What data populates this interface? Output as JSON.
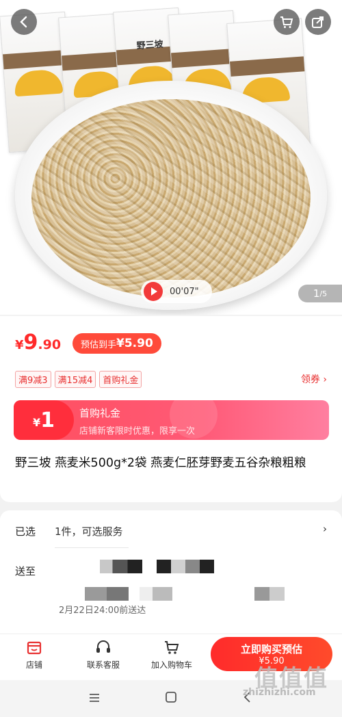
{
  "hero": {
    "video_time": "00'07\"",
    "image_counter_current": "1",
    "image_counter_total": "/5",
    "package_brand": "野三坡"
  },
  "price": {
    "currency": "¥",
    "integer": "9",
    "decimal": ".90",
    "estimate_label": "预估到手",
    "estimate_value": "¥5.90"
  },
  "coupons": [
    "满9减3",
    "满15减4",
    "首购礼金"
  ],
  "coupon_link": "领券 ›",
  "gift": {
    "currency": "¥",
    "amount": "1",
    "title": "首购礼金",
    "subtitle": "店铺新客限时优惠，限享一次"
  },
  "product_title": "野三坡 燕麦米500g*2袋 燕麦仁胚芽野麦五谷杂粮粗粮",
  "options": {
    "selected_label": "已选",
    "selected_value": "1件，可选服务",
    "ship_label": "送至",
    "delivery_text": "2月22日24:00前送达"
  },
  "bottom_tabs": [
    {
      "label": "店铺",
      "icon": "store-icon"
    },
    {
      "label": "联系客服",
      "icon": "headset-icon"
    },
    {
      "label": "加入购物车",
      "icon": "cart-icon"
    }
  ],
  "buy_button": {
    "line1": "立即购买预估",
    "line2": "¥5.90"
  },
  "watermark": {
    "line1": "值值值",
    "line2": "zhizhizhi.com"
  },
  "colors": {
    "accent": "#ff2a2a",
    "gift_bg": "#ff4e5e"
  }
}
